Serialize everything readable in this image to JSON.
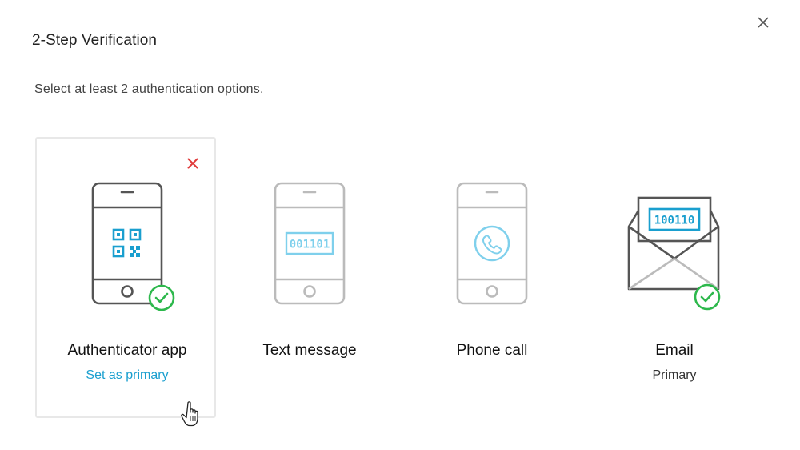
{
  "dialog": {
    "title": "2-Step Verification",
    "subtitle": "Select at least 2 authentication options."
  },
  "options": [
    {
      "label": "Authenticator app",
      "action": "Set as primary",
      "icon": "phone-qr-icon",
      "selected": true,
      "enabled": true
    },
    {
      "label": "Text message",
      "icon": "phone-sms-icon",
      "code": "001101",
      "selected": false,
      "enabled": false
    },
    {
      "label": "Phone call",
      "icon": "phone-call-icon",
      "selected": false,
      "enabled": false
    },
    {
      "label": "Email",
      "status": "Primary",
      "icon": "envelope-icon",
      "code": "100110",
      "selected": false,
      "enabled": true
    }
  ],
  "colors": {
    "accent": "#1a9fcf",
    "check": "#2db84c",
    "remove": "#e03a3a",
    "icon_active": "#555555",
    "icon_inactive": "#bbbbbb",
    "accent_inactive": "#7fd0ec"
  }
}
